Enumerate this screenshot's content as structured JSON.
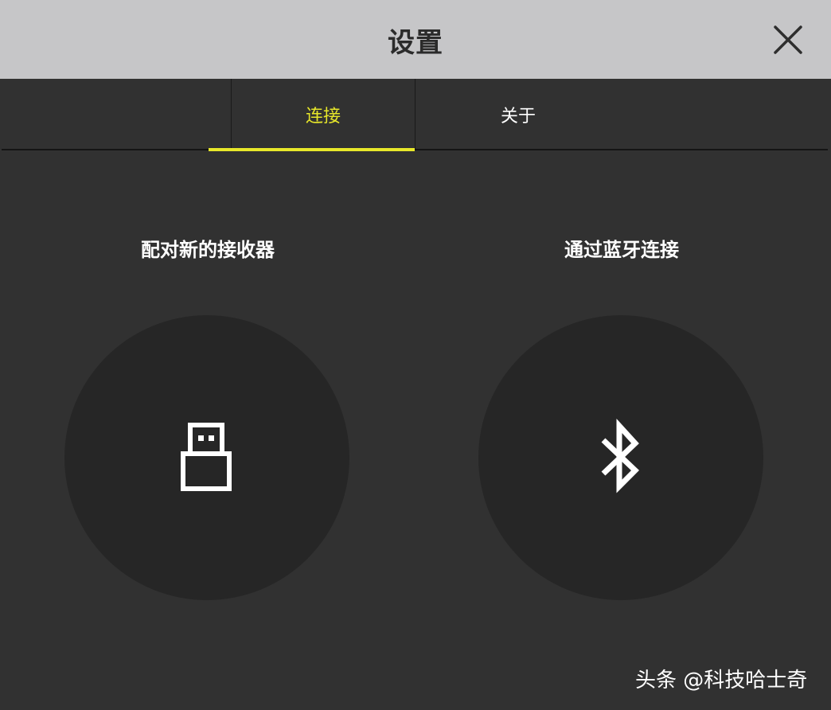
{
  "dialog": {
    "title": "设置"
  },
  "tabs": [
    {
      "label": "连接",
      "active": true
    },
    {
      "label": "关于",
      "active": false
    }
  ],
  "options": [
    {
      "label": "配对新的接收器",
      "icon": "usb-receiver-icon"
    },
    {
      "label": "通过蓝牙连接",
      "icon": "bluetooth-icon"
    }
  ],
  "watermark": "头条 @科技哈士奇",
  "colors": {
    "titlebar": "#c6c6c8",
    "background": "#313131",
    "circle": "#262626",
    "accent": "#e8e82a",
    "text": "#ffffff"
  }
}
